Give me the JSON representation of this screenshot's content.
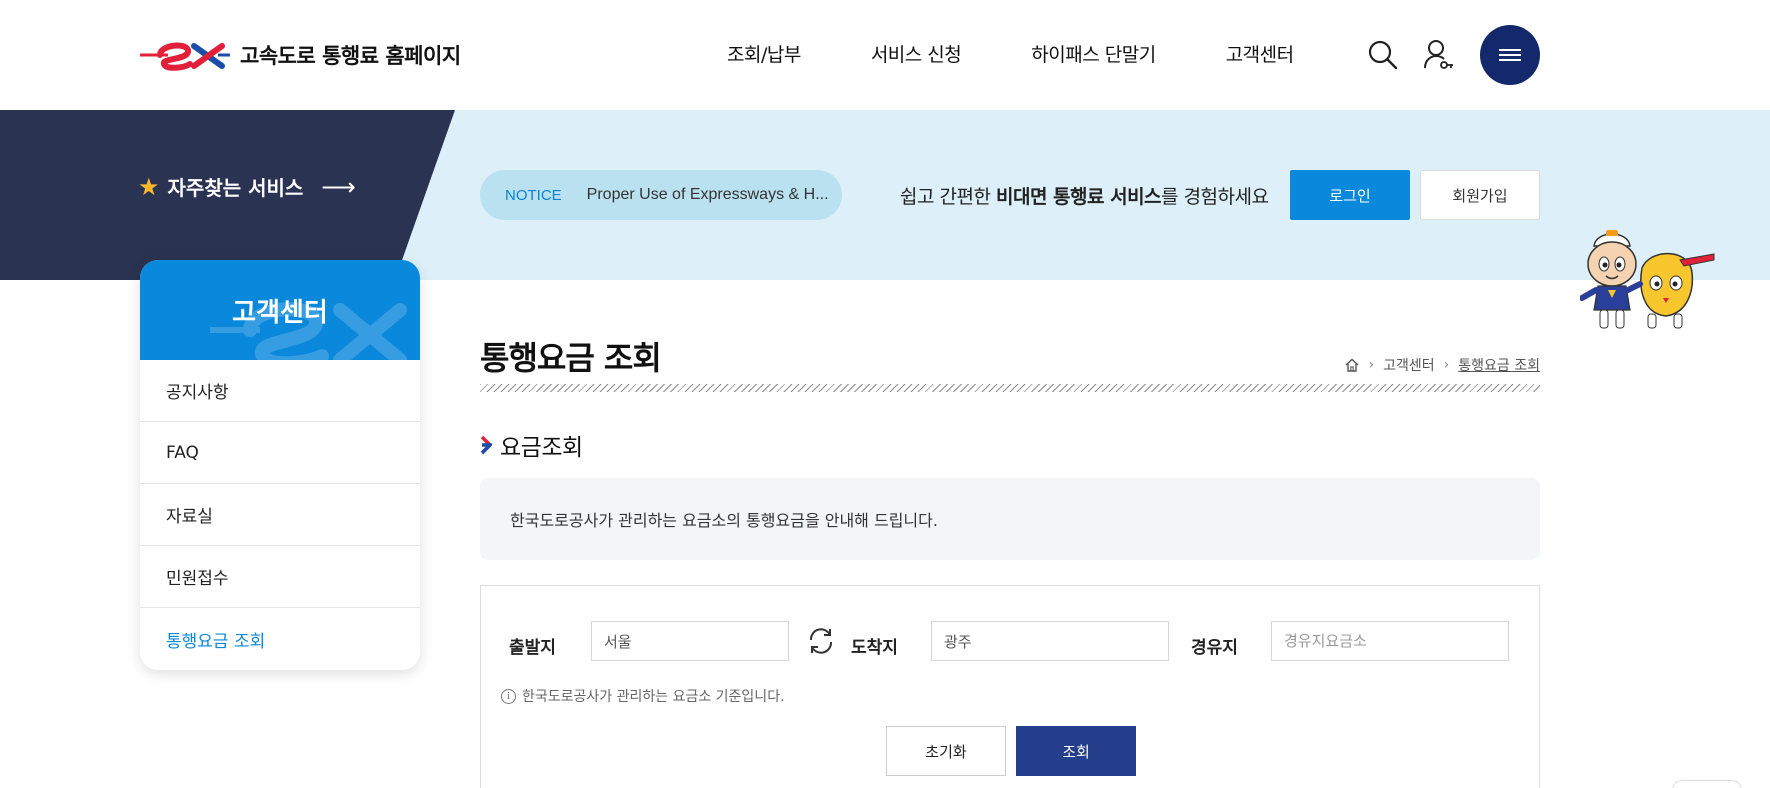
{
  "header": {
    "logo_text": "고속도로 통행료 홈페이지",
    "nav": [
      "조회/납부",
      "서비스 신청",
      "하이패스 단말기",
      "고객센터"
    ]
  },
  "banner": {
    "favorites_label": "자주찾는 서비스",
    "notice_tag": "NOTICE",
    "notice_text": "Proper Use of Expressways & H...",
    "promo_pre": "쉽고 간편한 ",
    "promo_bold": "비대면 통행료 서비스",
    "promo_post": "를 경험하세요",
    "login_label": "로그인",
    "join_label": "회원가입"
  },
  "sidebar": {
    "title": "고객센터",
    "items": [
      {
        "label": "공지사항"
      },
      {
        "label": "FAQ"
      },
      {
        "label": "자료실"
      },
      {
        "label": "민원접수"
      },
      {
        "label": "통행요금 조회"
      }
    ],
    "active_index": 4
  },
  "main": {
    "page_title": "통행요금 조회",
    "breadcrumb": [
      "고객센터",
      "통행요금 조회"
    ],
    "section_title": "요금조회",
    "info_text": "한국도로공사가 관리하는 요금소의 통행요금을 안내해 드립니다."
  },
  "form": {
    "origin_label": "출발지",
    "origin_value": "서울",
    "destination_label": "도착지",
    "destination_value": "광주",
    "via_label": "경유지",
    "via_placeholder": "경유지요금소",
    "note": "한국도로공사가 관리하는 요금소 기준입니다.",
    "reset_label": "초기화",
    "search_label": "조회"
  },
  "colors": {
    "brand_navy": "#13296b",
    "banner_dark": "#2b3352",
    "banner_light": "#ddeff8",
    "primary_blue": "#0a88dc",
    "search_button": "#263f8c",
    "logo_red": "#e2203a"
  },
  "icons": [
    "search-icon",
    "user-key-icon",
    "hamburger-icon",
    "star-icon",
    "arrow-right-icon",
    "home-icon",
    "chevron-right-icon",
    "swap-icon",
    "info-icon"
  ]
}
